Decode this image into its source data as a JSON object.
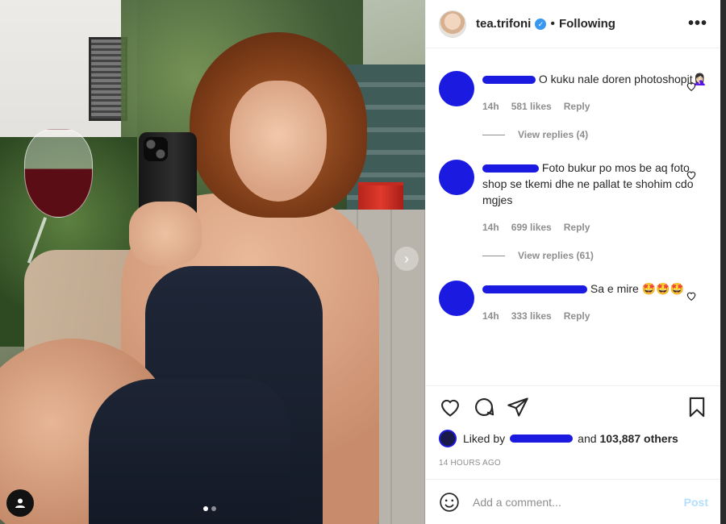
{
  "post": {
    "username": "tea.trifoni",
    "separator": "•",
    "follow_label": "Following",
    "more_label": "•••"
  },
  "comments": [
    {
      "text": "O kuku nale doren photoshopit🤦🏻‍♀️",
      "time": "14h",
      "likes": "581 likes",
      "reply_label": "Reply",
      "view_replies": "View replies (4)"
    },
    {
      "text": "Foto bukur po mos be aq foto shop se tkemi dhe ne pallat te shohim cdo mgjes",
      "time": "14h",
      "likes": "699 likes",
      "reply_label": "Reply",
      "view_replies": "View replies (61)"
    },
    {
      "text": "Sa e mire 🤩🤩🤩",
      "time": "14h",
      "likes": "333 likes",
      "reply_label": "Reply"
    }
  ],
  "likes": {
    "prefix": "Liked by",
    "middle": "and",
    "others": "103,887 others"
  },
  "timestamp": "14 HOURS AGO",
  "composer": {
    "placeholder": "Add a comment...",
    "post_label": "Post"
  }
}
